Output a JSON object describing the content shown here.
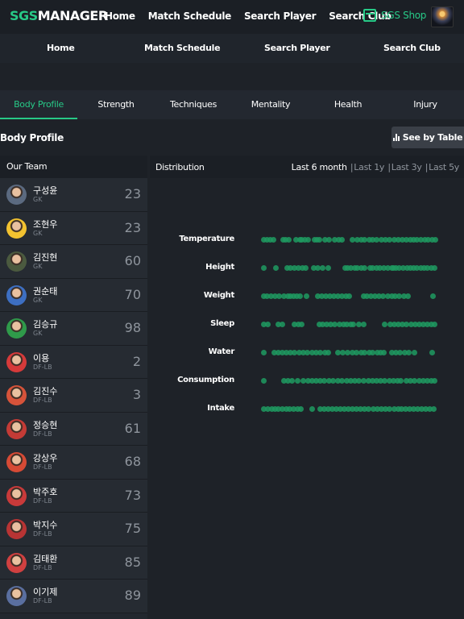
{
  "header": {
    "logo_accent": "SGS",
    "logo_main": "MANAGER",
    "nav": [
      "Home",
      "Match Schedule",
      "Search Player",
      "Search Club"
    ],
    "shop_label": "SGS Shop"
  },
  "subnav": [
    "Home",
    "Match Schedule",
    "Search Player",
    "Search Club"
  ],
  "tabs": [
    {
      "label": "Body Profile",
      "active": true
    },
    {
      "label": "Strength",
      "active": false
    },
    {
      "label": "Techniques",
      "active": false
    },
    {
      "label": "Mentality",
      "active": false
    },
    {
      "label": "Health",
      "active": false
    },
    {
      "label": "Injury",
      "active": false
    }
  ],
  "section": {
    "title": "Body Profile",
    "see_by_table": "See by Table"
  },
  "team": {
    "header": "Our Team",
    "players": [
      {
        "name": "구성윤",
        "position": "GK",
        "number": "23",
        "kit": "#5b6a80"
      },
      {
        "name": "조현우",
        "position": "GK",
        "number": "23",
        "kit": "#f2c230"
      },
      {
        "name": "김진현",
        "position": "GK",
        "number": "60",
        "kit": "#4b5a3f"
      },
      {
        "name": "권순태",
        "position": "GK",
        "number": "70",
        "kit": "#3d6fc2"
      },
      {
        "name": "김승규",
        "position": "GK",
        "number": "98",
        "kit": "#2f9a4a"
      },
      {
        "name": "이용",
        "position": "DF-LB",
        "number": "2",
        "kit": "#d63a3a"
      },
      {
        "name": "김진수",
        "position": "DF-LB",
        "number": "3",
        "kit": "#d6533a"
      },
      {
        "name": "정승현",
        "position": "DF-LB",
        "number": "61",
        "kit": "#c43b36"
      },
      {
        "name": "강상우",
        "position": "DF-LB",
        "number": "68",
        "kit": "#d64a35"
      },
      {
        "name": "박주호",
        "position": "DF-LB",
        "number": "73",
        "kit": "#c93a3a"
      },
      {
        "name": "박지수",
        "position": "DF-LB",
        "number": "75",
        "kit": "#b83434"
      },
      {
        "name": "김태환",
        "position": "DF-LB",
        "number": "85",
        "kit": "#d04040"
      },
      {
        "name": "이기제",
        "position": "DF-LB",
        "number": "89",
        "kit": "#5a6fa0"
      }
    ]
  },
  "distribution": {
    "title": "Distribution",
    "periods": [
      {
        "label": "Last 6 month",
        "active": true
      },
      {
        "label": "Last 1y",
        "active": false
      },
      {
        "label": "Last 3y",
        "active": false
      },
      {
        "label": "Last 5y",
        "active": false
      }
    ],
    "metrics": [
      {
        "label": "Temperature",
        "dots": [
          0,
          4,
          8,
          12,
          24,
          27,
          31,
          40,
          45,
          47,
          51,
          55,
          63,
          66,
          69,
          76,
          81,
          88,
          93,
          97,
          110,
          116,
          121,
          125,
          131,
          135,
          140,
          146,
          151,
          156,
          162,
          167,
          172,
          177,
          182,
          186,
          190,
          195,
          200,
          204,
          209,
          213
        ]
      },
      {
        "label": "Height",
        "dots": [
          0,
          15,
          29,
          33,
          38,
          43,
          48,
          52,
          62,
          67,
          73,
          80,
          101,
          104,
          108,
          113,
          116,
          121,
          125,
          132,
          135,
          140,
          144,
          149,
          154,
          159,
          161,
          164,
          168,
          173,
          178,
          182,
          186,
          190,
          195,
          199,
          203,
          208,
          212
        ]
      },
      {
        "label": "Weight",
        "dots": [
          0,
          4,
          9,
          14,
          19,
          25,
          30,
          33,
          37,
          41,
          45,
          53,
          67,
          72,
          77,
          82,
          87,
          92,
          97,
          102,
          106,
          124,
          128,
          133,
          138,
          143,
          148,
          154,
          159,
          163,
          168,
          174,
          179,
          210
        ]
      },
      {
        "label": "Sleep",
        "dots": [
          0,
          5,
          18,
          23,
          38,
          43,
          47,
          69,
          73,
          78,
          83,
          88,
          94,
          99,
          103,
          108,
          111,
          118,
          124,
          150,
          157,
          162,
          167,
          172,
          177,
          183,
          188,
          193,
          198,
          203,
          208,
          212
        ]
      },
      {
        "label": "Water",
        "dots": [
          0,
          13,
          18,
          23,
          28,
          33,
          38,
          44,
          49,
          54,
          60,
          65,
          70,
          76,
          80,
          92,
          98,
          104,
          110,
          115,
          121,
          125,
          131,
          135,
          141,
          145,
          149,
          159,
          164,
          169,
          175,
          180,
          187,
          209
        ]
      },
      {
        "label": "Consumption",
        "dots": [
          0,
          25,
          30,
          35,
          42,
          49,
          55,
          60,
          65,
          70,
          75,
          81,
          86,
          92,
          97,
          103,
          108,
          113,
          118,
          124,
          130,
          135,
          140,
          145,
          150,
          156,
          161,
          166,
          170,
          177,
          182,
          187,
          193,
          198,
          203,
          208,
          212
        ]
      },
      {
        "label": "Intake",
        "dots": [
          0,
          5,
          10,
          14,
          18,
          23,
          28,
          32,
          37,
          42,
          46,
          60,
          70,
          75,
          80,
          85,
          90,
          95,
          100,
          105,
          110,
          115,
          120,
          125,
          130,
          136,
          141,
          146,
          151,
          156,
          162,
          167,
          171,
          176,
          181,
          186,
          191,
          196,
          201,
          206,
          211
        ]
      }
    ]
  },
  "colors": {
    "accent": "#27c987",
    "dot": "#1f9a60"
  }
}
